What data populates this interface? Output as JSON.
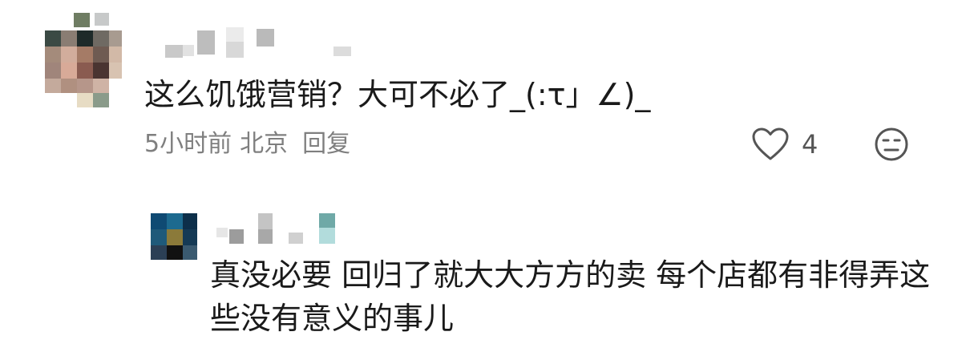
{
  "comment": {
    "text": "这么饥饿营销？大可不必了_(:τ」∠)_",
    "meta": {
      "time": "5小时前",
      "location": "北京",
      "reply_label": "回复"
    },
    "likes": "4",
    "icons": {
      "like": "heart-outline-icon",
      "dislike": "neutral-face-icon"
    }
  },
  "reply": {
    "text": "真没必要 回归了就大大方方的卖 每个店都有非得弄这些没有意义的事儿"
  },
  "colors": {
    "text": "#1a1a1a",
    "meta": "#7f7f7f",
    "icon": "#555555"
  }
}
